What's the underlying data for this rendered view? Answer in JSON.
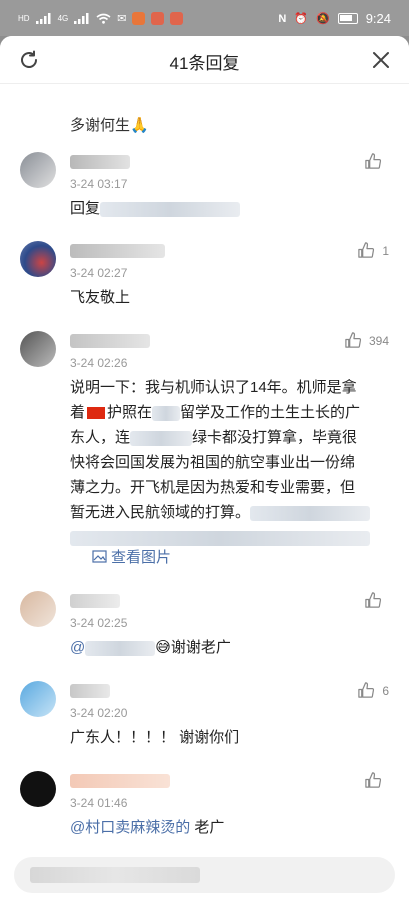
{
  "status_bar": {
    "time": "9:24",
    "left_chips": [
      "HD",
      "4G",
      "4G"
    ],
    "icons": [
      "signal-icon",
      "wifi-icon",
      "app-notification-icon",
      "weibo-icon",
      "nfc-icon",
      "alarm-icon",
      "mute-icon",
      "battery-icon"
    ]
  },
  "header": {
    "title": "41条回复",
    "refresh_icon": "refresh-icon",
    "close_icon": "close-icon"
  },
  "partial_top_text": "多谢何生",
  "comments": [
    {
      "time": "3-24 03:17",
      "text": "回复",
      "likes": ""
    },
    {
      "time": "3-24 02:27",
      "text": "飞友敬上",
      "likes": "1"
    },
    {
      "time": "3-24 02:26",
      "lines": [
        "说明一下：我与机师认识了14年。机师是拿",
        "着",
        "护照在",
        "留学及工作的土生土长的广",
        "东人，连",
        "绿卡都没打算拿，毕竟很",
        "快将会回国发展为祖国的航空事业出一份绵",
        "薄之力。开飞机是因为热爱和专业需要，但",
        "暂无进入民航领域的打算。"
      ],
      "likes": "394",
      "view_images": "查看图片"
    },
    {
      "time": "3-24 02:25",
      "text": "谢谢老广",
      "likes": ""
    },
    {
      "time": "3-24 02:20",
      "text": "广东人！！！！ 谢谢你们",
      "likes": "6"
    },
    {
      "time": "3-24 01:46",
      "mention": "@村口卖麻辣烫的",
      "text": " 老广",
      "likes": ""
    },
    {
      "time": "",
      "text": "",
      "likes": ""
    }
  ],
  "colors": {
    "accent_link": "#4b6fa8",
    "time_gray": "#999999",
    "dim_overlay": "#8e8e8e"
  }
}
